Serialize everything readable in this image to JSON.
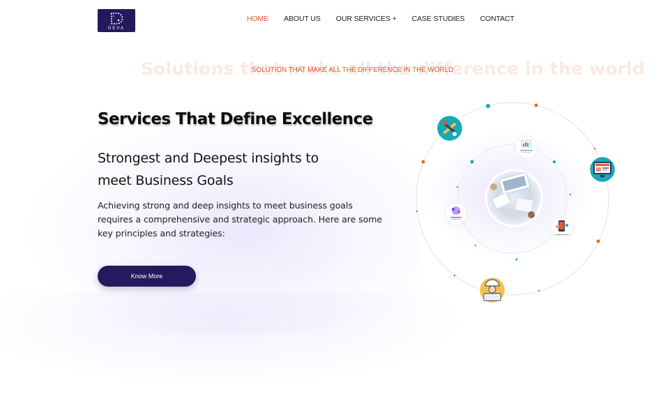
{
  "brand": {
    "logo_text": "DEVA",
    "color": "#23195e"
  },
  "nav": {
    "items": [
      {
        "label": "HOME",
        "active": true
      },
      {
        "label": "ABOUT US",
        "active": false
      },
      {
        "label": "OUR SERVICES +",
        "active": false
      },
      {
        "label": "CASE STUDIES",
        "active": false
      },
      {
        "label": "CONTACT",
        "active": false
      }
    ],
    "active_color": "#e4572e"
  },
  "hero": {
    "background_heading": "Solutions  that make all the difference in the world",
    "tagline": "SOLUTION THAT MAKE ALL THE DIFFERENCE IN THE WORLD",
    "title": "Services That Define Excellence",
    "subtitle": "Strongest and Deepest insights to meet Business Goals",
    "paragraph": "Achieving strong and deep insights to meet business goals requires a comprehensive and strategic approach. Here are some key principles and strategies:",
    "cta_label": "Know More"
  },
  "orbit_graphic": {
    "icons": [
      "tools-icon",
      "monitor-icon",
      "chart-card-icon",
      "mobile-app-icon",
      "engineer-icon",
      "network-card-icon",
      "team-meeting-image"
    ],
    "accent_colors": [
      "#1aa8b8",
      "#d9712a"
    ]
  }
}
